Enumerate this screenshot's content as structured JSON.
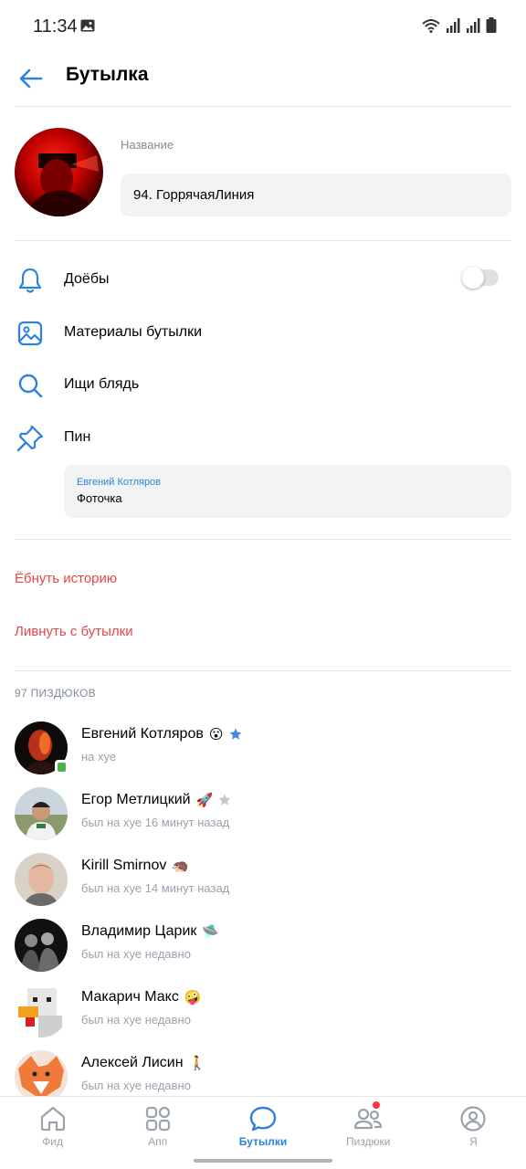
{
  "status_bar": {
    "time": "11:34"
  },
  "header": {
    "title": "Бутылка"
  },
  "chat": {
    "name_label": "Название",
    "name_value": "94. ГоррячаяЛиния"
  },
  "menu": {
    "notifications": "Доёбы",
    "materials": "Материалы бутылки",
    "search": "Ищи блядь",
    "pin": "Пин"
  },
  "pinned": {
    "author": "Евгений Котляров",
    "text": "Фоточка"
  },
  "actions": {
    "clear_history": "Ёбнуть историю",
    "leave": "Ливнуть с бутылки"
  },
  "members_count": "97 ПИЗДЮКОВ",
  "members": [
    {
      "name": "Евгений Котляров",
      "emoji": "😮",
      "status": "на хуе"
    },
    {
      "name": "Егор Метлицкий",
      "emoji": "🚀",
      "status": "был на хуе 16 минут назад"
    },
    {
      "name": "Kirill Smirnov",
      "emoji": "🦔",
      "status": "был на хуе 14 минут назад"
    },
    {
      "name": "Владимир Царик",
      "emoji": "🛸",
      "status": "был на хуе недавно"
    },
    {
      "name": "Макарич Макс",
      "emoji": "🤪",
      "status": "был на хуе недавно"
    },
    {
      "name": "Алексей Лисин",
      "emoji": "🚶",
      "status": "был на хуе недавно"
    }
  ],
  "tabs": [
    "Фид",
    "Апп",
    "Бутылки",
    "Пиздюки",
    "Я"
  ],
  "colors": {
    "accent": "#2d81e0",
    "danger": "#e64646",
    "secondary": "#818c99"
  }
}
